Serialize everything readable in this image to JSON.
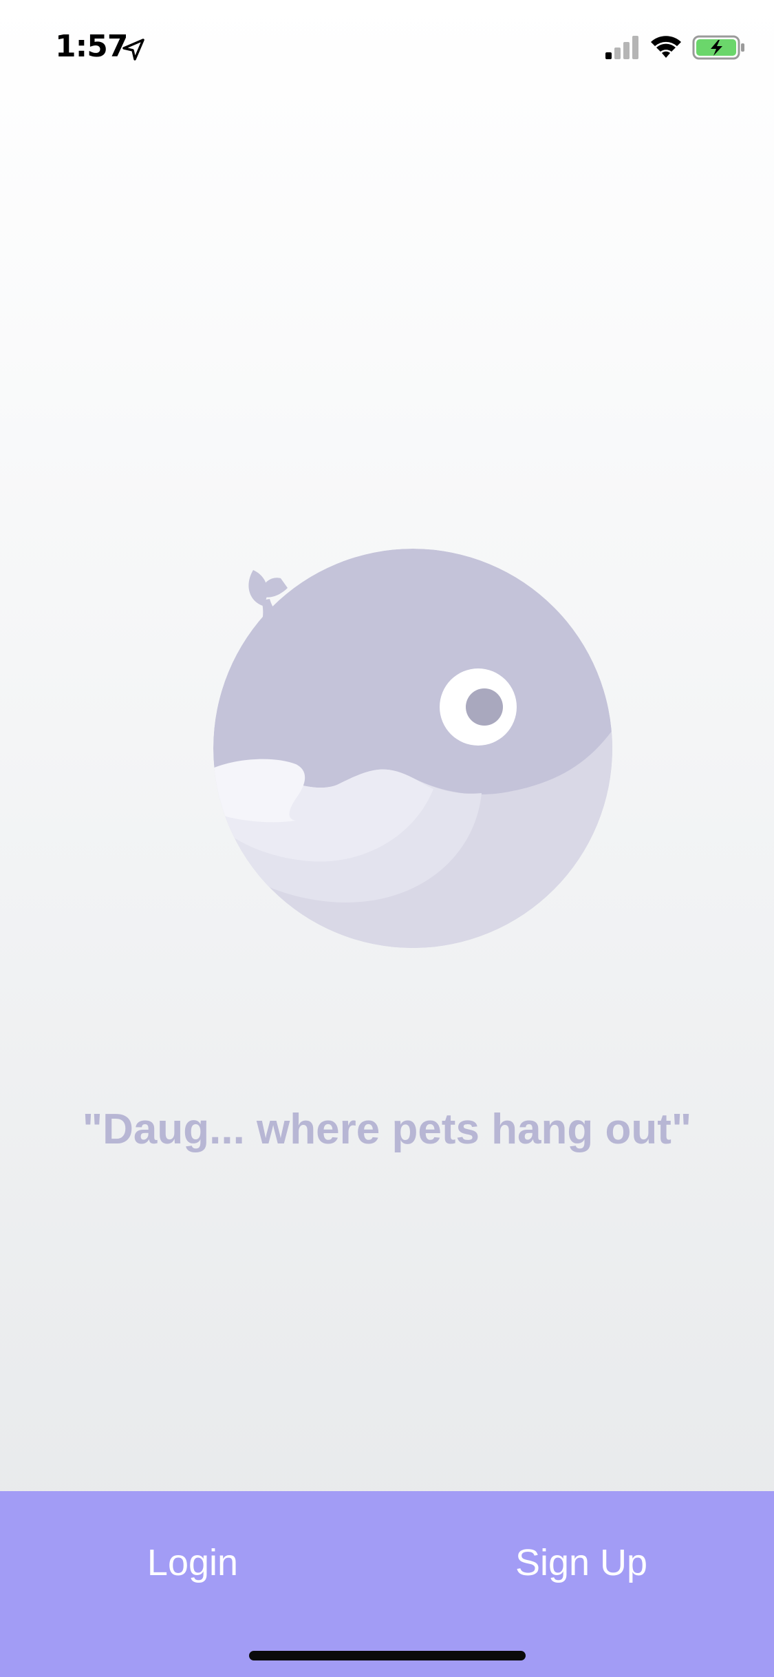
{
  "status_bar": {
    "time": "1:57",
    "location_icon": "location-arrow-icon",
    "signal_icon": "cellular-signal-icon",
    "wifi_icon": "wifi-icon",
    "battery_icon": "battery-charging-icon"
  },
  "hero": {
    "illustration": "whale-icon",
    "tagline": "\"Daug... where pets hang out\""
  },
  "bottom_bar": {
    "login_label": "Login",
    "signup_label": "Sign Up"
  },
  "colors": {
    "accent": "#a29cf5",
    "whale_body": "#c4c3d9",
    "tagline": "#b7b6d4",
    "battery_fill": "#6bd66b"
  }
}
